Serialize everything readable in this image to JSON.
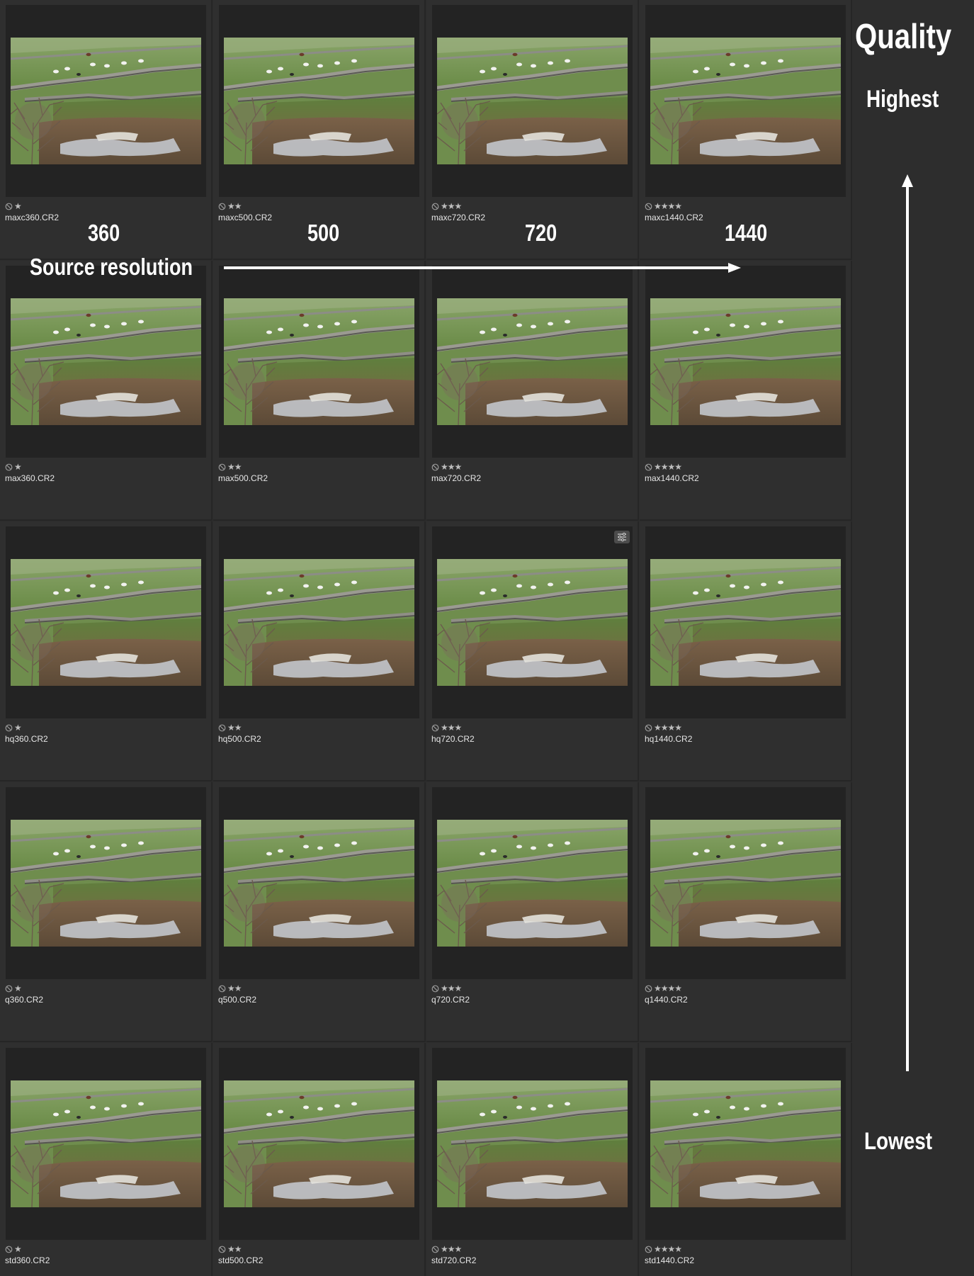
{
  "annotations": {
    "quality_title": "Quality",
    "highest_label": "Highest",
    "lowest_label": "Lowest",
    "source_resolution_label": "Source resolution",
    "resolutions": [
      "360",
      "500",
      "720",
      "1440"
    ]
  },
  "colors": {
    "background": "#2d2d2d",
    "cell_frame": "#232323",
    "star": "#bdbdbd",
    "annotation_text": "#ffffff"
  },
  "thumbnail_subject": "pasture-with-stone-walls-and-sheep",
  "grid": [
    [
      {
        "name": "maxc360.CR2",
        "stars": "★",
        "rating": 1
      },
      {
        "name": "maxc500.CR2",
        "stars": "★★",
        "rating": 2
      },
      {
        "name": "maxc720.CR2",
        "stars": "★★★",
        "rating": 3
      },
      {
        "name": "maxc1440.CR2",
        "stars": "★★★★",
        "rating": 4
      }
    ],
    [
      {
        "name": "max360.CR2",
        "stars": "★",
        "rating": 1
      },
      {
        "name": "max500.CR2",
        "stars": "★★",
        "rating": 2
      },
      {
        "name": "max720.CR2",
        "stars": "★★★",
        "rating": 3
      },
      {
        "name": "max1440.CR2",
        "stars": "★★★★",
        "rating": 4
      }
    ],
    [
      {
        "name": "hq360.CR2",
        "stars": "★",
        "rating": 1
      },
      {
        "name": "hq500.CR2",
        "stars": "★★",
        "rating": 2
      },
      {
        "name": "hq720.CR2",
        "stars": "★★★",
        "rating": 3,
        "adjusted": true
      },
      {
        "name": "hq1440.CR2",
        "stars": "★★★★",
        "rating": 4
      }
    ],
    [
      {
        "name": "q360.CR2",
        "stars": "★",
        "rating": 1
      },
      {
        "name": "q500.CR2",
        "stars": "★★",
        "rating": 2
      },
      {
        "name": "q720.CR2",
        "stars": "★★★",
        "rating": 3
      },
      {
        "name": "q1440.CR2",
        "stars": "★★★★",
        "rating": 4
      }
    ],
    [
      {
        "name": "std360.CR2",
        "stars": "★",
        "rating": 1
      },
      {
        "name": "std500.CR2",
        "stars": "★★",
        "rating": 2
      },
      {
        "name": "std720.CR2",
        "stars": "★★★",
        "rating": 3
      },
      {
        "name": "std1440.CR2",
        "stars": "★★★★",
        "rating": 4
      }
    ]
  ]
}
